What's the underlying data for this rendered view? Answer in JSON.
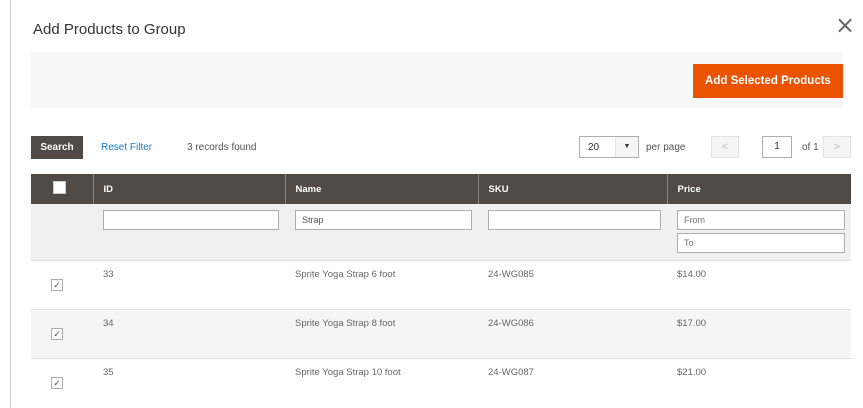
{
  "modal": {
    "title": "Add Products to Group",
    "close_icon": "close-icon",
    "add_button": "Add Selected Products"
  },
  "toolbar": {
    "search_label": "Search",
    "reset_label": "Reset Filter",
    "records_text": "3 records found",
    "per_page_value": "20",
    "per_page_label": "per page",
    "page_prev": "<",
    "page_next": ">",
    "page_current": "1",
    "page_of": "of 1"
  },
  "grid": {
    "columns": [
      "ID",
      "Name",
      "SKU",
      "Price"
    ],
    "filters": {
      "id": "",
      "name": "Strap",
      "sku": "",
      "price_from_placeholder": "From",
      "price_to_placeholder": "To"
    },
    "rows": [
      {
        "id": "33",
        "name": "Sprite Yoga Strap 6 foot",
        "sku": "24-WG085",
        "price": "$14.00",
        "checked": true
      },
      {
        "id": "34",
        "name": "Sprite Yoga Strap 8 foot",
        "sku": "24-WG086",
        "price": "$17.00",
        "checked": true
      },
      {
        "id": "35",
        "name": "Sprite Yoga Strap 10 foot",
        "sku": "24-WG087",
        "price": "$21.00",
        "checked": true
      }
    ]
  },
  "colors": {
    "accent": "#eb5202",
    "header_bg": "#514943",
    "link": "#1979c3"
  }
}
